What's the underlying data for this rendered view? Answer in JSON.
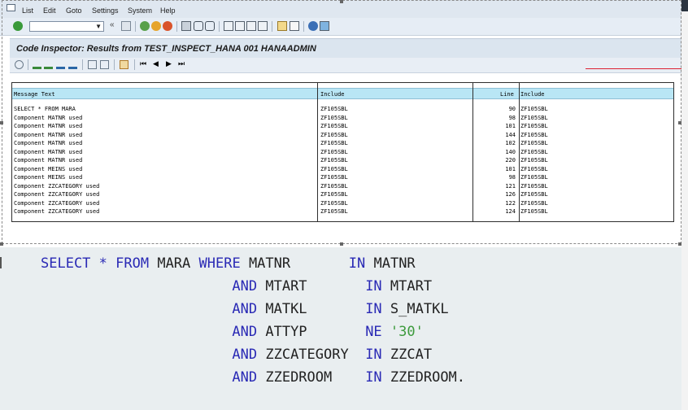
{
  "menubar": {
    "items": [
      "List",
      "Edit",
      "Goto",
      "Settings",
      "System",
      "Help"
    ]
  },
  "toolbar": {
    "command_field_value": "",
    "icons": [
      "enter-icon",
      "save-icon",
      "back-icon",
      "exit-icon",
      "cancel-icon",
      "print-icon",
      "find-icon",
      "find-next-icon",
      "first-page-icon",
      "previous-page-icon",
      "next-page-icon",
      "last-page-icon",
      "new-session-icon",
      "shortcut-icon",
      "help-icon",
      "customize-layout-icon"
    ]
  },
  "title": "Code Inspector: Results from TEST_INSPECT_HANA 001 HANAADMIN",
  "grid": {
    "columns": [
      "Message Text",
      "Include",
      "Line",
      "Include"
    ],
    "rows": [
      {
        "msg": "SELECT * FROM MARA",
        "inc": "ZF105SBL",
        "line": "90",
        "inc2": "ZF105SBL"
      },
      {
        "msg": "Component MATNR used",
        "inc": "ZF105SBL",
        "line": "98",
        "inc2": "ZF105SBL"
      },
      {
        "msg": "Component MATNR used",
        "inc": "ZF105SBL",
        "line": "101",
        "inc2": "ZF105SBL"
      },
      {
        "msg": "Component MATNR used",
        "inc": "ZF105SBL",
        "line": "144",
        "inc2": "ZF105SBL"
      },
      {
        "msg": "Component MATNR used",
        "inc": "ZF105SBL",
        "line": "102",
        "inc2": "ZF105SBL"
      },
      {
        "msg": "Component MATNR used",
        "inc": "ZF105SBL",
        "line": "140",
        "inc2": "ZF105SBL"
      },
      {
        "msg": "Component MATNR used",
        "inc": "ZF105SBL",
        "line": "220",
        "inc2": "ZF105SBL"
      },
      {
        "msg": "Component MEINS used",
        "inc": "ZF105SBL",
        "line": "101",
        "inc2": "ZF105SBL"
      },
      {
        "msg": "Component MEINS used",
        "inc": "ZF105SBL",
        "line": "98",
        "inc2": "ZF105SBL"
      },
      {
        "msg": "Component ZZCATEGORY used",
        "inc": "ZF105SBL",
        "line": "121",
        "inc2": "ZF105SBL"
      },
      {
        "msg": "Component ZZCATEGORY used",
        "inc": "ZF105SBL",
        "line": "126",
        "inc2": "ZF105SBL"
      },
      {
        "msg": "Component ZZCATEGORY used",
        "inc": "ZF105SBL",
        "line": "122",
        "inc2": "ZF105SBL"
      },
      {
        "msg": "Component ZZCATEGORY used",
        "inc": "ZF105SBL",
        "line": "124",
        "inc2": "ZF105SBL"
      }
    ]
  },
  "code": {
    "lines": [
      [
        "SELECT",
        " * ",
        "FROM",
        " MARA ",
        "WHERE",
        " MATNR       ",
        "IN",
        " MATNR"
      ],
      [
        "",
        "",
        "",
        "                       ",
        "AND",
        " MTART       ",
        "IN",
        " MTART"
      ],
      [
        "",
        "",
        "",
        "                       ",
        "AND",
        " MATKL       ",
        "IN",
        " S_MATKL"
      ],
      [
        "",
        "",
        "",
        "                       ",
        "AND",
        " ATTYP       ",
        "NE",
        " '30'"
      ],
      [
        "",
        "",
        "",
        "                       ",
        "AND",
        " ZZCATEGORY  ",
        "IN",
        " ZZCAT"
      ],
      [
        "",
        "",
        "",
        "                       ",
        "AND",
        " ZZEDROOM    ",
        "IN",
        " ZZEDROOM."
      ]
    ]
  },
  "colors": {
    "keyword": "#2a2ab5",
    "string": "#3c9a3c",
    "grid_header": "#b9e6f5"
  }
}
